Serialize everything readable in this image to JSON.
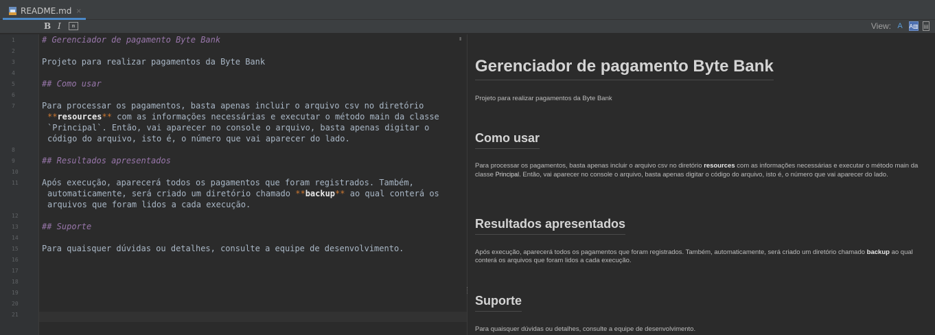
{
  "tab": {
    "label": "README.md",
    "close": "×"
  },
  "toolbar": {
    "bold": "B",
    "italic": "I",
    "code": "m",
    "view_label": "View:",
    "view_text": "A",
    "view_split": "A▥",
    "view_preview": "▤"
  },
  "gutter": {
    "lines": [
      "1",
      "2",
      "3",
      "4",
      "5",
      "6",
      "7",
      "8",
      "9",
      "10",
      "11",
      "12",
      "13",
      "14",
      "15",
      "16",
      "17",
      "18",
      "19",
      "20",
      "21"
    ]
  },
  "editor": {
    "line1": "# Gerenciador de pagamento Byte Bank",
    "line3": "Projeto para realizar pagamentos da Byte Bank",
    "line5": "## Como usar",
    "line7a": "Para processar os pagamentos, basta apenas incluir o arquivo csv no diretório",
    "line7b_mark": "**",
    "line7b_bold": "resources",
    "line7b_rest": " com as informações necessárias e executar o método main da classe",
    "line7c": "`Principal`. Então, vai aparecer no console o arquivo, basta apenas digitar o",
    "line7d": "código do arquivo, isto é, o número que vai aparecer do lado.",
    "line9": "## Resultados apresentados",
    "line11a": "Após execução, aparecerá todos os pagamentos que foram registrados. Também,",
    "line11b_pre": "automaticamente, será criado um diretório chamado ",
    "line11b_bold": "backup",
    "line11b_post": " ao qual conterá os",
    "line11c": "arquivos que foram lidos a cada execução.",
    "line13": "## Suporte",
    "line15": "Para quaisquer dúvidas ou detalhes, consulte a equipe de desenvolvimento.",
    "pause": "II"
  },
  "preview": {
    "h1": "Gerenciador de pagamento Byte Bank",
    "p1": "Projeto para realizar pagamentos da Byte Bank",
    "h2_usage": "Como usar",
    "p2_a": "Para processar os pagamentos, basta apenas incluir o arquivo csv no diretório ",
    "p2_bold": "resources",
    "p2_b": " com as informações necessárias e executar o método main da classe ",
    "p2_code": "Principal",
    "p2_c": ". Então, vai aparecer no console o arquivo, basta apenas digitar o código do arquivo, isto é, o número que vai aparecer do lado.",
    "h2_results": "Resultados apresentados",
    "p3_a": "Após execução, aparecerá todos os pagamentos que foram registrados. Também, automaticamente, será criado um diretório chamado ",
    "p3_bold": "backup",
    "p3_b": " ao qual conterá os arquivos que foram lidos a cada execução.",
    "h2_support": "Suporte",
    "p4": "Para quaisquer dúvidas ou detalhes, consulte a equipe de desenvolvimento."
  },
  "colors": {
    "accent": "#4a88c7",
    "heading_markdown": "#9876aa",
    "bold_marker": "#cc7832",
    "editor_bg": "#2b2b2b"
  }
}
